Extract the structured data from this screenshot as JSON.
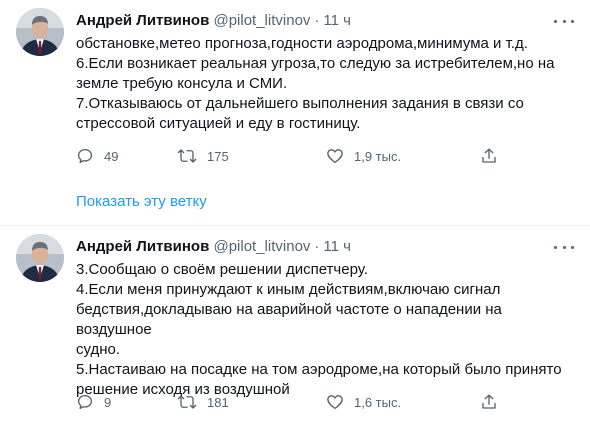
{
  "tweets": [
    {
      "author": "Андрей Литвинов",
      "handle": "@pilot_litvinov",
      "separator": "·",
      "time": "11 ч",
      "lines": [
        "обстановке,метео прогноза,годности аэродрома,минимума и т.д.",
        "6.Если возникает реальная угроза,то следую за истребителем,но на",
        "земле требую консула и СМИ.",
        "7.Отказываюсь от дальнейшего выполнения задания в связи со",
        "стрессовой ситуацией и еду в гостиницу."
      ],
      "replies": "49",
      "retweets": "175",
      "likes": "1,9 тыс."
    },
    {
      "author": "Андрей Литвинов",
      "handle": "@pilot_litvinov",
      "separator": "·",
      "time": "11 ч",
      "lines": [
        "3.Сообщаю о своём решении диспетчеру.",
        "4.Если меня принуждают к иным действиям,включаю сигнал",
        "бедствия,докладываю на аварийной частоте о нападении на воздушное",
        "судно.",
        "5.Настаиваю на посадке на том аэродроме,на который было принято",
        "решение исходя из воздушной"
      ],
      "replies": "9",
      "retweets": "181",
      "likes": "1,6 тыс."
    }
  ],
  "show_thread": "Показать эту ветку",
  "icons": {
    "reply": "reply-icon",
    "retweet": "retweet-icon",
    "like": "heart-icon",
    "share": "share-icon",
    "more": "more-icon"
  },
  "colors": {
    "text": "#0f1419",
    "secondary": "#536471",
    "link": "#1d9bf0",
    "divider": "#eff3f4"
  }
}
